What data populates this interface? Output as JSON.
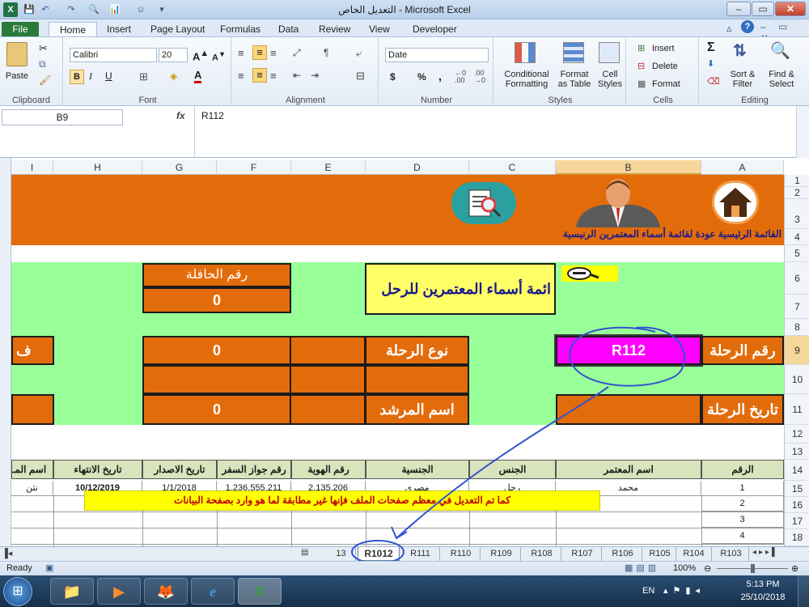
{
  "window": {
    "title": "التعديل الخاص  -  Microsoft Excel",
    "controls": [
      "–",
      "▭",
      "✕"
    ]
  },
  "quick_access": [
    "💾",
    "↶",
    "↷",
    "🔍",
    "📊",
    "☺",
    "▾"
  ],
  "ribbon_tabs": [
    "File",
    "Home",
    "Insert",
    "Page Layout",
    "Formulas",
    "Data",
    "Review",
    "View",
    "Developer"
  ],
  "ribbon": {
    "clipboard": {
      "label": "Clipboard",
      "paste": "Paste"
    },
    "font": {
      "label": "Font",
      "name": "Calibri",
      "size": "20",
      "bold": "B",
      "italic": "I",
      "underline": "U"
    },
    "alignment": {
      "label": "Alignment"
    },
    "number": {
      "label": "Number",
      "format": "Date",
      "currency": "$",
      "percent": "%",
      "comma": ","
    },
    "styles": {
      "label": "Styles",
      "conditional": "Conditional Formatting",
      "table": "Format as Table",
      "cell": "Cell Styles"
    },
    "cells": {
      "label": "Cells",
      "insert": "Insert",
      "delete": "Delete",
      "format": "Format"
    },
    "editing": {
      "label": "Editing",
      "sort": "Sort & Filter",
      "find": "Find & Select",
      "sigma": "Σ"
    }
  },
  "formula_bar": {
    "name_box": "B9",
    "fx": "fx",
    "value": "R112"
  },
  "columns": [
    "I",
    "H",
    "G",
    "F",
    "E",
    "D",
    "C",
    "B",
    "A"
  ],
  "rows": [
    "1",
    "2",
    "3",
    "4",
    "5",
    "6",
    "7",
    "8",
    "9",
    "10",
    "11",
    "12",
    "13",
    "14",
    "15",
    "16",
    "17",
    "18"
  ],
  "sheet": {
    "nav_links": "القائمة الرئيسية  عودة لقائمة  أسماء المعتمرين الرنيسية",
    "bus_number_label": "رقم الحافلة",
    "bus_number_value": "0",
    "list_title": "ائمة أسماء المعتمرين للرحل",
    "trip_type_label": "نوع الرحلة",
    "trip_type_value": "0",
    "trip_number_label": "رقم الرحلة",
    "trip_number_value": "R112",
    "guide_label": "اسم المرشد",
    "guide_value": "0",
    "trip_date_label": "تاريخ الرحلة",
    "partial_left": "ف",
    "headers": [
      "اسم المـ",
      "تاريخ الانتهاء",
      "تاريخ الاصدار",
      "رقم جواز السفر",
      "رقم الهوية",
      "الجنسية",
      "الجنس",
      "اسم المعتمر",
      "الرقم"
    ],
    "row15": [
      "نثن",
      "10/12/2019",
      "1/1/2018",
      "1,236,555,211",
      "2,135,206",
      "مصري",
      "رجل",
      "محمد",
      "1"
    ],
    "row_numbers": [
      "1",
      "2",
      "3",
      "4"
    ],
    "note": "كما تم التعديل في معظم صفحات الملف فإنها غير مطابقة لما هو وارد بصفحة البيانات"
  },
  "sheet_tabs": [
    "13",
    "R1012",
    "R111",
    "R110",
    "R109",
    "R108",
    "R107",
    "R106",
    "R105",
    "R104",
    "R103"
  ],
  "status": {
    "ready": "Ready",
    "zoom": "100%"
  },
  "taskbar": {
    "lang": "EN",
    "time": "5:13 PM",
    "date": "25/10/2018"
  }
}
